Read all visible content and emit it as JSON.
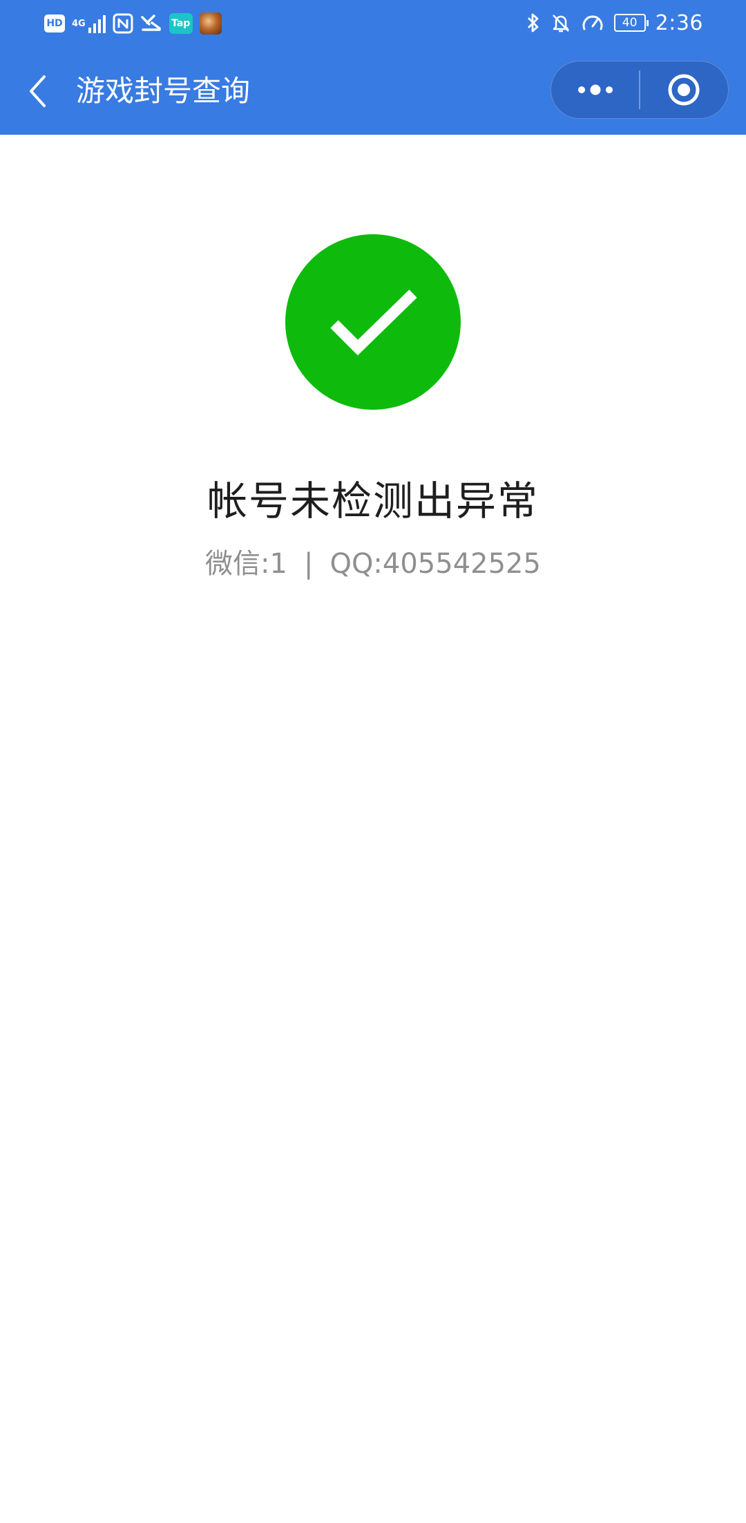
{
  "status_bar": {
    "hd_label": "HD",
    "network_label": "4G",
    "tap_label": "Tap",
    "battery_level": "40",
    "time": "2:36"
  },
  "nav": {
    "title": "游戏封号查询"
  },
  "result": {
    "status": "success",
    "title": "帐号未检测出异常",
    "wechat_label": "微信:1",
    "separator": "|",
    "qq_label": "QQ:405542525"
  },
  "colors": {
    "header_blue": "#387be2",
    "capsule_blue": "#2d66c4",
    "success_green": "#0ebb0d",
    "title_text": "#1e1e1e",
    "sub_text": "#8f8f8f"
  },
  "icons": {
    "back": "chevron-left-icon",
    "more": "more-dots-icon",
    "close": "target-circle-icon",
    "result": "checkmark-icon"
  }
}
